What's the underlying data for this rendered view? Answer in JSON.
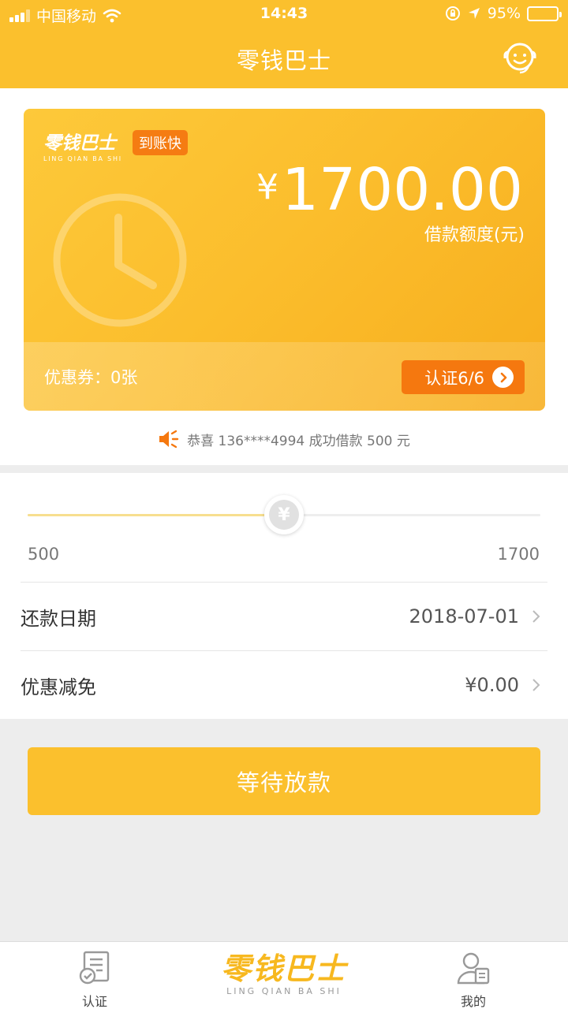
{
  "status_bar": {
    "carrier": "中国移动",
    "time": "14:43",
    "battery": "95%"
  },
  "header": {
    "title": "零钱巴士",
    "support_icon": "customer-service-icon"
  },
  "card": {
    "brand_cn": "零钱巴士",
    "brand_en": "LING QIAN BA SHI",
    "tag": "到账快",
    "currency_symbol": "¥",
    "amount": "1700.00",
    "amount_label": "借款额度(元)",
    "coupon": "优惠券：0张",
    "verify_button": "认证6/6"
  },
  "notice": {
    "text": "恭喜 136****4994 成功借款 500 元"
  },
  "slider": {
    "min_label": "500",
    "max_label": "1700",
    "thumb_symbol": "¥",
    "min": 500,
    "max": 1700,
    "value": 1100
  },
  "rows": [
    {
      "label": "还款日期",
      "value": "2018-07-01"
    },
    {
      "label": "优惠减免",
      "value": "¥0.00"
    }
  ],
  "primary_button": "等待放款",
  "tabbar": {
    "left_label": "认证",
    "logo_cn": "零钱巴士",
    "logo_en": "LING QIAN BA SHI",
    "right_label": "我的"
  },
  "colors": {
    "brand": "#fbc02d",
    "accent_orange": "#f5780f"
  }
}
